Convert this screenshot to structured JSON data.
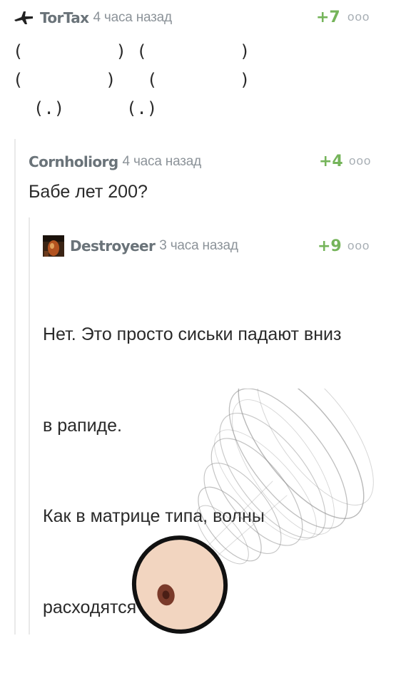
{
  "comments": [
    {
      "author": "TorTax",
      "time": "4 часа назад",
      "rating": "+7",
      "more": "ooo",
      "body": "(         ) (         )\n(        )   (        )\n  (.)      (.)"
    },
    {
      "author": "Cornholiorg",
      "time": "4 часа назад",
      "rating": "+4",
      "more": "ooo",
      "body": "Бабе лет 200?"
    },
    {
      "author": "Destroyeer",
      "time": "3 часа назад",
      "rating": "+9",
      "more": "ooo",
      "body_lines": [
        "Нет. Это просто сиськи падают вниз",
        "в рапиде.",
        "Как в матрице типа, волны",
        "расходятся"
      ]
    }
  ],
  "icons": {
    "avatar_1": "airplane-icon",
    "avatar_3": "user-photo-avatar"
  },
  "colors": {
    "rating": "#75b45a",
    "author": "#6a7379",
    "thread_line": "#e9e9e9"
  }
}
